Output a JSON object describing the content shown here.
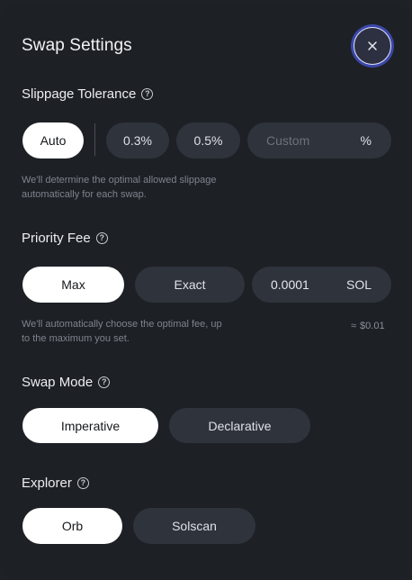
{
  "header": {
    "title": "Swap Settings",
    "close_icon": "close-icon"
  },
  "slippage": {
    "label": "Slippage Tolerance",
    "help_icon": "help-icon",
    "options": [
      {
        "label": "Auto",
        "selected": true
      },
      {
        "label": "0.3%",
        "selected": false
      },
      {
        "label": "0.5%",
        "selected": false
      }
    ],
    "custom_placeholder": "Custom",
    "custom_value": "",
    "custom_unit": "%",
    "hint_line1": "We'll determine the optimal allowed slippage",
    "hint_line2": "automatically for each swap."
  },
  "priority_fee": {
    "label": "Priority Fee",
    "help_icon": "help-icon",
    "options": [
      {
        "label": "Max",
        "selected": true
      },
      {
        "label": "Exact",
        "selected": false
      }
    ],
    "amount_value": "0.0001",
    "amount_unit": "SOL",
    "hint_line1": "We'll automatically choose the optimal fee, up",
    "hint_line2": "to the maximum you set.",
    "estimate_symbol": "≈",
    "estimate_value": "$0.01"
  },
  "swap_mode": {
    "label": "Swap Mode",
    "help_icon": "help-icon",
    "options": [
      {
        "label": "Imperative",
        "selected": true
      },
      {
        "label": "Declarative",
        "selected": false
      }
    ]
  },
  "explorer": {
    "label": "Explorer",
    "help_icon": "help-icon",
    "options": [
      {
        "label": "Orb",
        "selected": true
      },
      {
        "label": "Solscan",
        "selected": false
      }
    ]
  },
  "colors": {
    "background": "#1d2025",
    "pill": "#2f333c",
    "active_pill": "#ffffff",
    "focus_ring": "#3b47a8"
  }
}
